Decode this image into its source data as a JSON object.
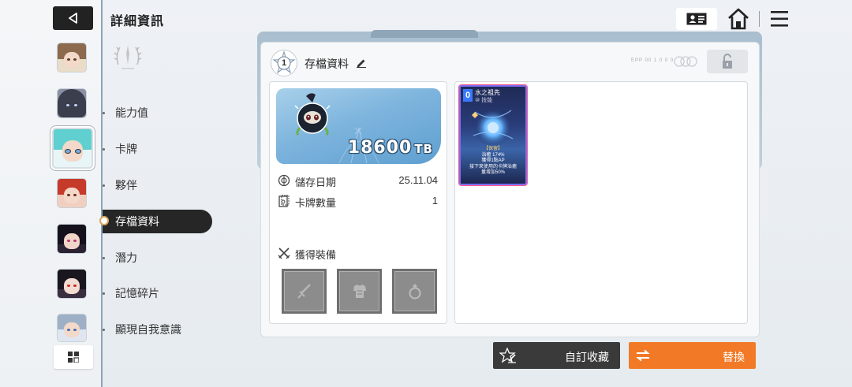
{
  "header": {
    "title": "詳細資訊"
  },
  "nav": {
    "items": [
      {
        "label": "能力值"
      },
      {
        "label": "卡牌"
      },
      {
        "label": "夥伴"
      },
      {
        "label": "存檔資料"
      },
      {
        "label": "潛力"
      },
      {
        "label": "記憶碎片"
      },
      {
        "label": "顯現自我意識"
      }
    ],
    "active_index": 3
  },
  "panel": {
    "slot_number": "1",
    "slot_title": "存檔資料",
    "faint_label": "EPP 00 1 0 0 0"
  },
  "save_info": {
    "tb_value": "18600",
    "tb_unit": "TB",
    "save_date_label": "儲存日期",
    "save_date": "25.11.04",
    "card_count_label": "卡牌數量",
    "card_count": "1",
    "equipment_label": "獲得裝備",
    "equipment_slots": [
      "sword-icon",
      "armor-icon",
      "ring-icon"
    ]
  },
  "card": {
    "cost": "0",
    "name": "水之祖先",
    "type": "⑩ 技能",
    "tag": "【保留】",
    "desc_line1": "治癒 174%",
    "desc_line2": "獲得1點AP",
    "desc_line3": "接下來使用的卡牌治癒",
    "desc_line4": "量增加50%"
  },
  "buttons": {
    "custom_label": "自訂收藏",
    "replace_label": "替換"
  },
  "colors": {
    "accent_orange": "#f27a27",
    "dark_button": "#3a3a3a",
    "active_nav": "#262626"
  }
}
